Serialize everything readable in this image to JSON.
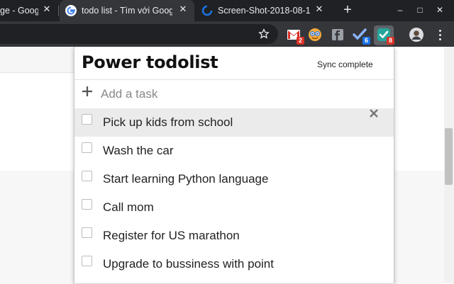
{
  "tabs": [
    {
      "title": "ge - Googl",
      "favicon": "google-icon"
    },
    {
      "title": "todo list - Tìm với Goog",
      "favicon": "google-icon"
    },
    {
      "title": "Screen-Shot-2018-08-1",
      "favicon": "loading-icon"
    }
  ],
  "extensions": [
    {
      "name": "gmail-extension-icon",
      "badge": "2",
      "badge_color": "#d93025"
    },
    {
      "name": "face-extension-icon",
      "badge": ""
    },
    {
      "name": "facebook-extension-icon",
      "badge": ""
    },
    {
      "name": "checkmark-extension-icon",
      "badge": "6",
      "badge_color": "#1a73e8"
    },
    {
      "name": "power-todolist-extension-icon",
      "badge": "8",
      "badge_color": "#d93025"
    }
  ],
  "popup": {
    "title": "Power todolist",
    "sync_status": "Sync complete",
    "add_placeholder": "Add a task",
    "tasks": [
      "Pick up kids from school",
      "Wash the car",
      "Start learning Python language",
      "Call mom",
      "Register for US marathon",
      "Upgrade to bussiness with point"
    ]
  },
  "colors": {
    "tabstrip": "#202124",
    "toolbar": "#35363a",
    "todolist_accent": "#26a69a"
  }
}
